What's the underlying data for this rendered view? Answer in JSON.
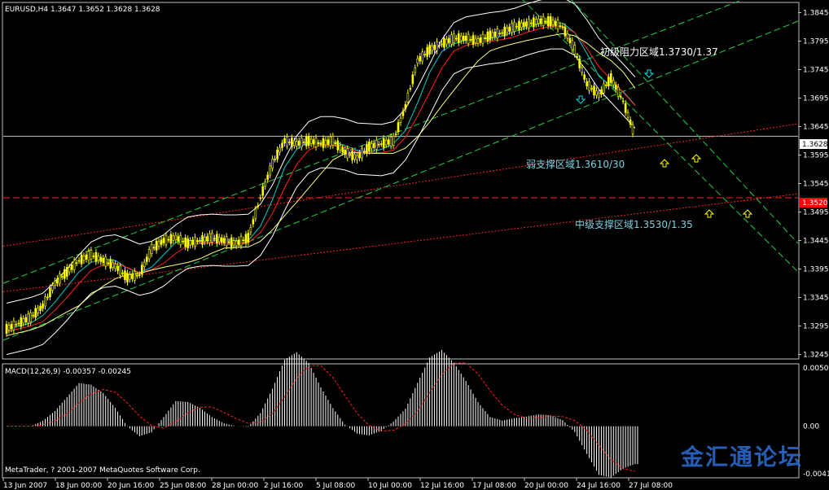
{
  "chart_data": [
    {
      "type": "line",
      "title": "EURUSD,H4  1.3647 1.3652 1.3628 1.3628",
      "ylim": [
        1.324,
        1.386
      ],
      "y_ticks": [
        "1.3845",
        "1.3795",
        "1.3745",
        "1.3695",
        "1.3645",
        "1.3595",
        "1.3545",
        "1.3495",
        "1.3445",
        "1.3395",
        "1.3345",
        "1.3295",
        "1.3245"
      ],
      "x_ticks": [
        "13 Jun 2007",
        "18 Jun 00:00",
        "20 Jun 16:00",
        "25 Jun 08:00",
        "28 Jun 00:00",
        "2 Jul 16:00",
        "5 Jul 08:00",
        "10 Jul 00:00",
        "12 Jul 16:00",
        "17 Jul 08:00",
        "20 Jul 00:00",
        "24 Jul 16:00",
        "27 Jul 08:00"
      ],
      "current_price": "1.3628",
      "marked_price": "1.3520",
      "series": [
        {
          "values": [
            1.329,
            1.33,
            1.331,
            1.333,
            1.337,
            1.339,
            1.341,
            1.342,
            1.341,
            1.34,
            1.338,
            1.3385,
            1.343,
            1.3445,
            1.345,
            1.344,
            1.3445,
            1.345,
            1.3445,
            1.344,
            1.345,
            1.352,
            1.358,
            1.362,
            1.3615,
            1.362,
            1.3615,
            1.362,
            1.36,
            1.359,
            1.361,
            1.3615,
            1.362,
            1.368,
            1.376,
            1.378,
            1.379,
            1.38,
            1.38,
            1.3795,
            1.3805,
            1.381,
            1.382,
            1.3825,
            1.383,
            1.383,
            1.382,
            1.378,
            1.372,
            1.37,
            1.373,
            1.369,
            1.3628
          ]
        }
      ],
      "annotations": [
        "初级阻力区域1.3730/1.37",
        "弱支撑区域1.3610/30",
        "中级支撑区域1.3530/1.35"
      ]
    },
    {
      "type": "bar",
      "title": "MACD(12,26,9) -0.00357 -0.00245",
      "y_ticks": [
        "0.00509",
        "0.00",
        "-0.00415"
      ],
      "ylim": [
        -0.00415,
        0.00509
      ]
    }
  ],
  "copyright": "MetaTrader, ? 2001-2007 MetaQuotes Software Corp.",
  "watermark": "金汇通论坛"
}
